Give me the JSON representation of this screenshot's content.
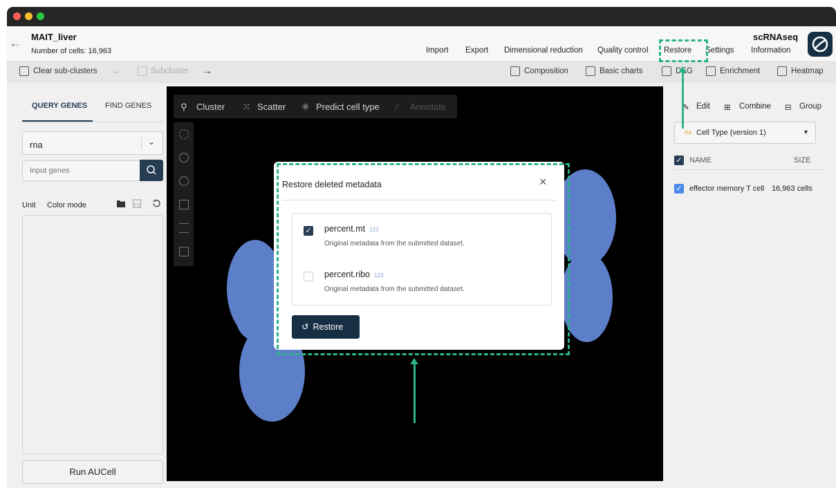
{
  "header": {
    "project_name": "MAIT_liver",
    "cell_count": "Number of cells: 16,963",
    "app_title": "scRNAseq",
    "nav": [
      {
        "label": "Import"
      },
      {
        "label": "Export"
      },
      {
        "label": "Dimensional reduction"
      },
      {
        "label": "Quality control"
      },
      {
        "label": "Restore"
      },
      {
        "label": "Settings"
      },
      {
        "label": "Information"
      }
    ]
  },
  "toolbar": {
    "clear_subclusters": "Clear sub-clusters",
    "subcluster": "Subcluster",
    "composition": "Composition",
    "basic_charts": "Basic charts",
    "deg": "DEG",
    "enrichment": "Enrichment",
    "heatmap": "Heatmap"
  },
  "left_panel": {
    "tabs": [
      "QUERY GENES",
      "FIND GENES"
    ],
    "active_tab": "QUERY GENES",
    "assay_select": "rna",
    "gene_input_placeholder": "Input genes",
    "unit_label": "Unit",
    "color_mode_label": "Color mode",
    "run_button": "Run AUCell"
  },
  "canvas": {
    "tools": [
      "Cluster",
      "Scatter",
      "Predict cell type",
      "Annotate"
    ]
  },
  "right_panel": {
    "edit": "Edit",
    "combine": "Combine",
    "group": "Group",
    "annotation_icon": "Aa",
    "annotation_select": "Cell Type (version 1)",
    "col_name": "NAME",
    "col_size": "SIZE",
    "rows": [
      {
        "name": "effector memory T cell",
        "size": "16,963 cells",
        "checked": true
      }
    ]
  },
  "modal": {
    "title": "Restore deleted metadata",
    "items": [
      {
        "label": "percent.mt",
        "type_badge": "123",
        "desc": "Original metadata from the submitted dataset.",
        "checked": true
      },
      {
        "label": "percent.ribo",
        "type_badge": "123",
        "desc": "Original metadata from the submitted dataset.",
        "checked": false
      }
    ],
    "restore_button": "Restore"
  },
  "colors": {
    "accent_dark": "#172f45",
    "checkbox_blue": "#4a8ae8",
    "umap_points": "#5d7ec9",
    "highlight_green": "#2db48c"
  }
}
